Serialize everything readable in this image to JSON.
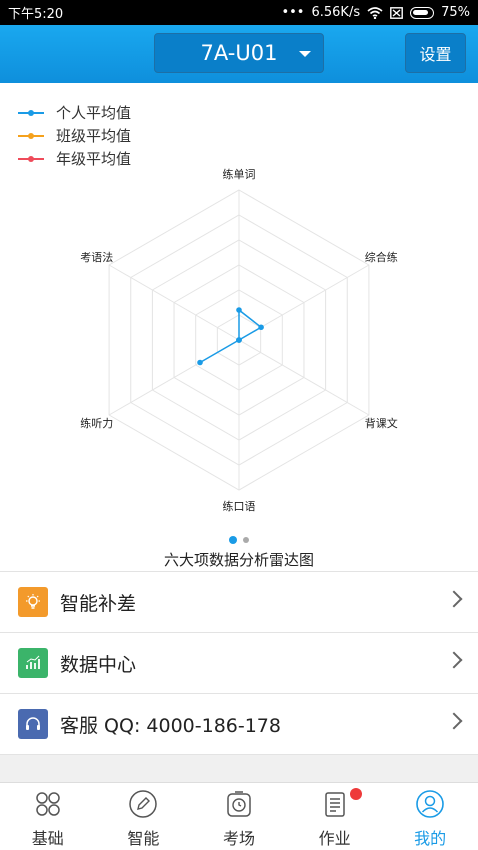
{
  "status_bar": {
    "time": "下午5:20",
    "network_speed": "6.56K/s",
    "battery": "75%"
  },
  "header": {
    "unit_selector": "7A-U01",
    "settings_label": "设置"
  },
  "legend": [
    {
      "label": "个人平均值",
      "color": "#1a9be6"
    },
    {
      "label": "班级平均值",
      "color": "#f5a11c"
    },
    {
      "label": "年级平均值",
      "color": "#ef4b5a"
    }
  ],
  "chart_data": {
    "type": "radar",
    "title": "六大项数据分析雷达图",
    "axes": [
      "练单词",
      "综合练",
      "背课文",
      "练口语",
      "练听力",
      "考语法"
    ],
    "rings": 6,
    "series": [
      {
        "name": "个人平均值",
        "values": [
          0.2,
          0.17,
          0,
          0,
          0.3,
          0
        ]
      }
    ]
  },
  "pager": {
    "pages": 2,
    "active": 0
  },
  "menu": {
    "items": [
      {
        "label": "智能补差",
        "icon": "lightbulb-icon",
        "color": "#f39a2b"
      },
      {
        "label": "数据中心",
        "icon": "bar-chart-icon",
        "color": "#3bb46a"
      },
      {
        "label": "客服 QQ: 4000-186-178",
        "icon": "headset-icon",
        "color": "#4a6ab0"
      }
    ]
  },
  "bottom_nav": {
    "items": [
      {
        "label": "基础",
        "icon": "grid-icon"
      },
      {
        "label": "智能",
        "icon": "pen-icon"
      },
      {
        "label": "考场",
        "icon": "clock-icon"
      },
      {
        "label": "作业",
        "icon": "document-icon"
      },
      {
        "label": "我的",
        "icon": "user-icon"
      }
    ],
    "active": "我的"
  }
}
